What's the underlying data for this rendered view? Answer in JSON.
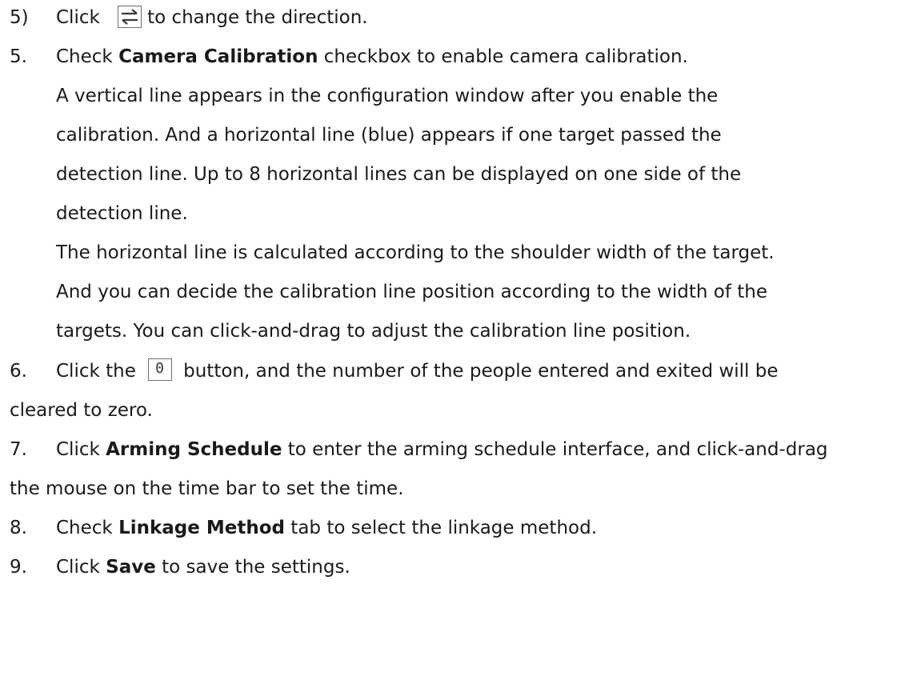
{
  "steps": {
    "s5_sub": {
      "num": "5)",
      "pre": "Click",
      "post": "to change the direction."
    },
    "s5": {
      "num": "5.",
      "a": "Check ",
      "bold": "Camera Calibration",
      "b": " checkbox to enable camera calibration.",
      "para1": [
        "A vertical line appears in the configuration window after you enable the",
        "calibration. And a horizontal line (blue) appears if one target passed the",
        "detection line. Up to 8 horizontal lines can be displayed on one side of the",
        "detection line."
      ],
      "para2": [
        "The horizontal line is calculated according to the shoulder width of the target.",
        "And you can decide the calibration line position according to the width of the",
        "targets. You can click-and-drag to adjust the calibration line position."
      ]
    },
    "s6": {
      "num": "6.",
      "a": "Click the",
      "icon_text": "0",
      "b": "button, and the number of the people entered and exited will be",
      "cont": "cleared to zero."
    },
    "s7": {
      "num": "7.",
      "a": "Click ",
      "bold": "Arming Schedule",
      "b": " to enter the arming schedule interface, and click-and-drag",
      "cont": "the mouse on the time bar to set the time."
    },
    "s8": {
      "num": "8.",
      "a": "Check ",
      "bold": "Linkage Method",
      "b": " tab to select the linkage method."
    },
    "s9": {
      "num": "9.",
      "a": "Click ",
      "bold": "Save",
      "b": " to save the settings."
    }
  },
  "icons": {
    "swap": "swap-direction-icon",
    "zero": "clear-zero-button"
  }
}
